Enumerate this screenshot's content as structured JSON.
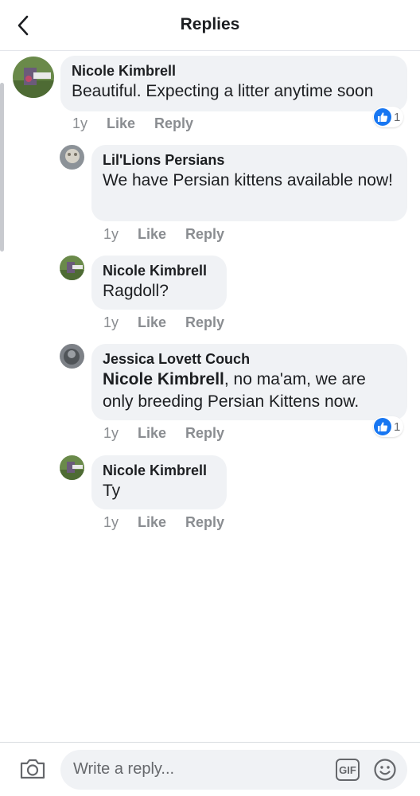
{
  "header": {
    "title": "Replies",
    "back_icon": "chevron-left-icon"
  },
  "comments": [
    {
      "author": "Nicole Kimbrell",
      "text": "Beautiful. Expecting a litter anytime soon",
      "time": "1y",
      "like_label": "Like",
      "reply_label": "Reply",
      "reaction_count": "1"
    },
    {
      "author": "Lil'Lions Persians",
      "text": "We have Persian kittens available now!",
      "time": "1y",
      "like_label": "Like",
      "reply_label": "Reply"
    },
    {
      "author": "Nicole Kimbrell",
      "text": "Ragdoll?",
      "time": "1y",
      "like_label": "Like",
      "reply_label": "Reply"
    },
    {
      "author": "Jessica Lovett Couch",
      "mention": "Nicole Kimbrell",
      "text": ", no ma'am, we are only breeding Persian Kittens now.",
      "time": "1y",
      "like_label": "Like",
      "reply_label": "Reply",
      "reaction_count": "1"
    },
    {
      "author": "Nicole Kimbrell",
      "text": "Ty",
      "time": "1y",
      "like_label": "Like",
      "reply_label": "Reply"
    }
  ],
  "composer": {
    "placeholder": "Write a reply...",
    "gif_label": "GIF"
  },
  "colors": {
    "accent": "#1877f2",
    "bubble": "#f0f2f5",
    "muted": "#8a8d91"
  }
}
